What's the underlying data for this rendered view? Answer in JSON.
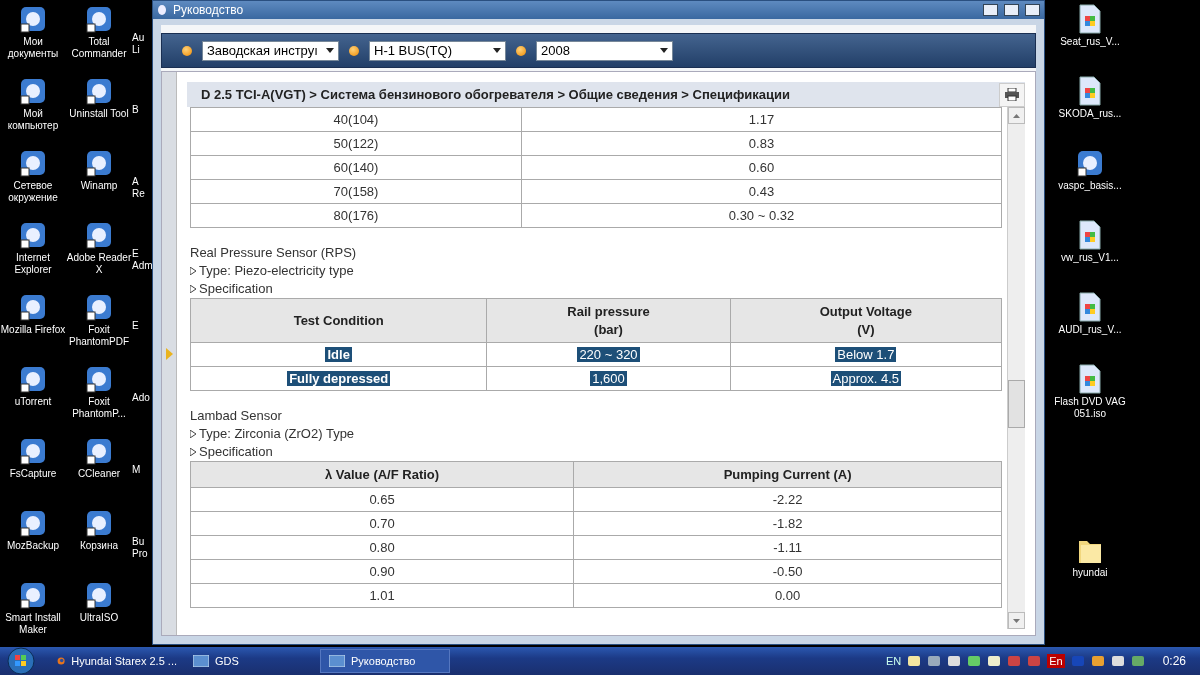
{
  "desktop_left": [
    {
      "kind": "app",
      "label": "Мои\nдокументы"
    },
    {
      "kind": "app",
      "label": "Total\nCommander"
    },
    {
      "kind": "hidden",
      "label": "Au\nLi"
    },
    {
      "kind": "app",
      "label": "Мой\nкомпьютер"
    },
    {
      "kind": "app",
      "label": "Uninstall Tool"
    },
    {
      "kind": "hidden",
      "label": "B"
    },
    {
      "kind": "app",
      "label": "Сетевое\nокружение"
    },
    {
      "kind": "app",
      "label": "Winamp"
    },
    {
      "kind": "hidden",
      "label": "A\nRe"
    },
    {
      "kind": "app",
      "label": "Internet\nExplorer"
    },
    {
      "kind": "app",
      "label": "Adobe Reader\nX"
    },
    {
      "kind": "hidden",
      "label": "E\nAdm"
    },
    {
      "kind": "app",
      "label": "Mozilla Firefox"
    },
    {
      "kind": "app",
      "label": "Foxit\nPhantomPDF"
    },
    {
      "kind": "hidden",
      "label": "E"
    },
    {
      "kind": "app",
      "label": "uTorrent"
    },
    {
      "kind": "app",
      "label": "Foxit\nPhantomP..."
    },
    {
      "kind": "hidden",
      "label": "Ado"
    },
    {
      "kind": "app",
      "label": "FsCapture"
    },
    {
      "kind": "app",
      "label": "CCleaner"
    },
    {
      "kind": "hidden",
      "label": "M"
    },
    {
      "kind": "app",
      "label": "MozBackup"
    },
    {
      "kind": "app",
      "label": "Корзина"
    },
    {
      "kind": "hidden",
      "label": "Bu\nPro"
    },
    {
      "kind": "app",
      "label": "Smart Install\nMaker"
    },
    {
      "kind": "app",
      "label": "UltraISO"
    }
  ],
  "desktop_right": [
    {
      "kind": "file",
      "label": "Seat_rus_V..."
    },
    {
      "kind": "file",
      "label": "SKODA_rus..."
    },
    {
      "kind": "app",
      "label": "vaspc_basis..."
    },
    {
      "kind": "file",
      "label": "vw_rus_V1..."
    },
    {
      "kind": "file",
      "label": "AUDI_rus_V..."
    },
    {
      "kind": "file",
      "label": "Flash DVD VAG\n051.iso"
    },
    {
      "kind": "folder",
      "label": "hyundai"
    }
  ],
  "window": {
    "title": "Руководство",
    "selectors": [
      {
        "value": "Заводская инструı"
      },
      {
        "value": "H-1 BUS(TQ)"
      },
      {
        "value": "2008"
      }
    ],
    "breadcrumb": "D 2.5 TCI-A(VGT) > Система бензинового обогревателя > Общие сведения > Спецификации",
    "content": [
      {
        "kind": "table",
        "rows": [
          {
            "cells": [
              "40(104)",
              "1.17"
            ]
          },
          {
            "cells": [
              "50(122)",
              "0.83"
            ]
          },
          {
            "cells": [
              "60(140)",
              "0.60"
            ]
          },
          {
            "cells": [
              "70(158)",
              "0.43"
            ]
          },
          {
            "cells": [
              "80(176)",
              "0.30 ~ 0.32"
            ]
          }
        ]
      },
      {
        "kind": "heading",
        "text": "Real Pressure Sensor (RPS)"
      },
      {
        "kind": "bullet",
        "text": "Type: Piezo-electricity type"
      },
      {
        "kind": "bullet",
        "text": "Specification"
      },
      {
        "kind": "table",
        "columns": [
          "Test Condition",
          "Rail pressure\n(bar)",
          "Output Voltage\n(V)"
        ],
        "rows": [
          {
            "cells": [
              "Idle",
              "220 ~ 320",
              "Below 1.7"
            ],
            "highlighted": true
          },
          {
            "cells": [
              "Fully depressed",
              "1,600",
              "Approx. 4.5"
            ],
            "highlighted": true
          }
        ]
      },
      {
        "kind": "heading",
        "text": "Lambad Sensor"
      },
      {
        "kind": "bullet",
        "text": "Type: Zirconia (ZrO2) Type"
      },
      {
        "kind": "bullet",
        "text": "Specification"
      },
      {
        "kind": "table",
        "columns": [
          "λ Value (A/F Ratio)",
          "Pumping Current (A)"
        ],
        "rows": [
          {
            "cells": [
              "0.65",
              "-2.22"
            ]
          },
          {
            "cells": [
              "0.70",
              "-1.82"
            ]
          },
          {
            "cells": [
              "0.80",
              "-1.11"
            ]
          },
          {
            "cells": [
              "0.90",
              "-0.50"
            ]
          },
          {
            "cells": [
              "1.01",
              "0.00"
            ]
          }
        ]
      }
    ]
  },
  "taskbar": {
    "tasks": [
      {
        "label": "Hyundai Starex 2.5 ...",
        "selected": false,
        "kind": "browser"
      },
      {
        "label": "GDS",
        "selected": false,
        "kind": "gds"
      },
      {
        "label": "Руководство",
        "selected": true,
        "kind": "gds"
      }
    ],
    "language": "EN",
    "tray_lang": "En",
    "clock": "0:26"
  }
}
